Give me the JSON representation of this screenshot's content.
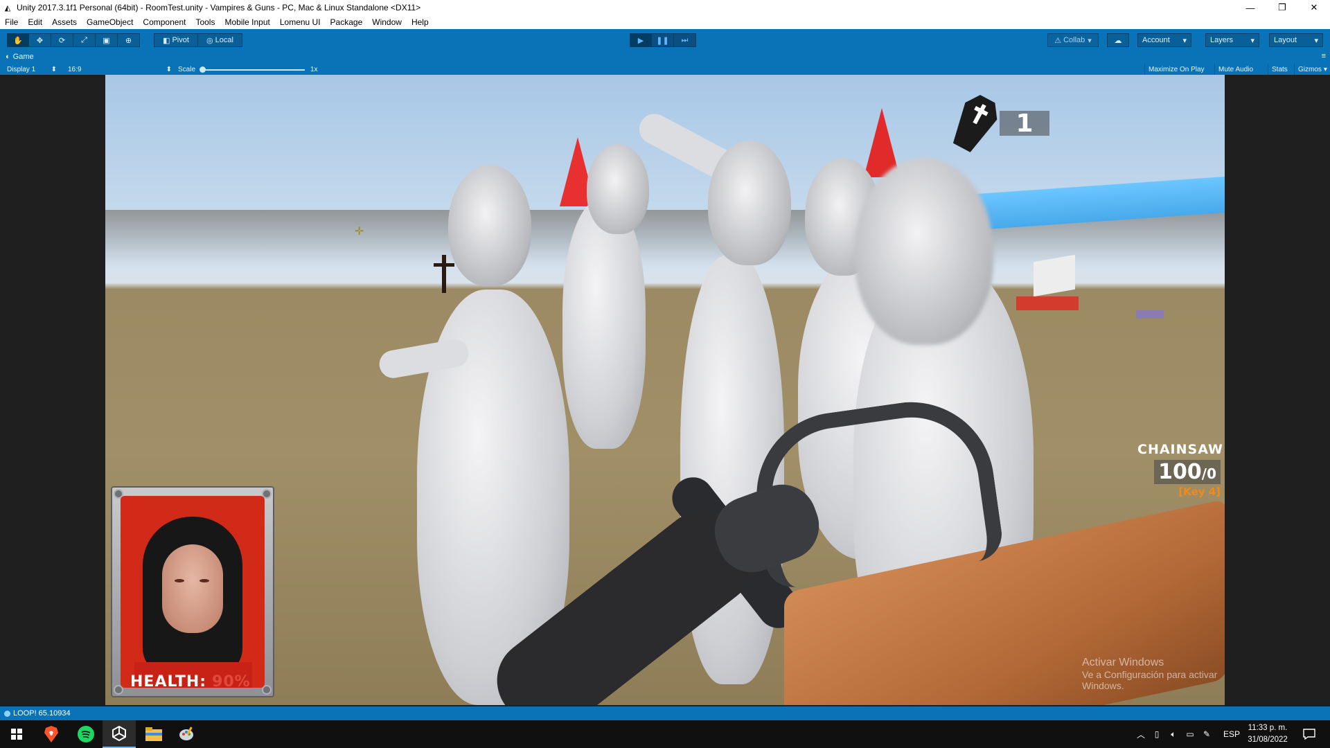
{
  "window": {
    "title": "Unity 2017.3.1f1 Personal (64bit) - RoomTest.unity - Vampires & Guns - PC, Mac & Linux Standalone <DX11>",
    "minimize": "—",
    "restore": "❐",
    "close": "✕"
  },
  "menu": [
    "File",
    "Edit",
    "Assets",
    "GameObject",
    "Component",
    "Tools",
    "Mobile Input",
    "Lomenu UI",
    "Package",
    "Window",
    "Help"
  ],
  "toolbar": {
    "pivot": "Pivot",
    "local": "Local",
    "collab": "Collab",
    "account": "Account",
    "layers": "Layers",
    "layout": "Layout",
    "accent_color": "#0a73b7"
  },
  "game_tab": {
    "label": "Game",
    "display": "Display 1",
    "aspect": "16:9",
    "scale_label": "Scale",
    "scale_value": "1x",
    "maximize": "Maximize On Play",
    "mute": "Mute Audio",
    "stats": "Stats",
    "gizmos": "Gizmos"
  },
  "hud": {
    "kill_count": "1",
    "health_label": "HEALTH:",
    "health_value": "90%",
    "weapon_name": "CHAINSAW",
    "ammo_current": "100",
    "ammo_total": "/0",
    "weapon_key": "[Key 4]"
  },
  "watermark": {
    "line1": "Activar Windows",
    "line2": "Ve a Configuración para activar Windows."
  },
  "statusbar": {
    "message": "LOOP! 65.10934"
  },
  "taskbar": {
    "lang": "ESP",
    "time": "11:33 p. m.",
    "date": "31/08/2022"
  }
}
